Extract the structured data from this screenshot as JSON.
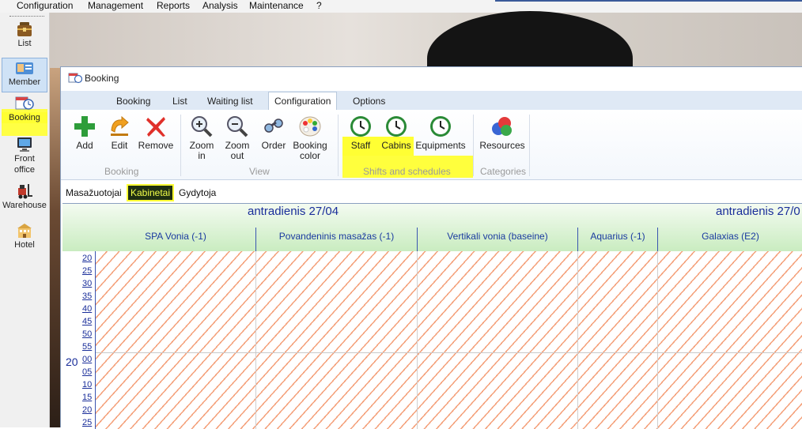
{
  "menu": {
    "items": [
      "Configuration",
      "Management",
      "Reports",
      "Analysis",
      "Maintenance",
      "?"
    ]
  },
  "sidebar": {
    "items": [
      {
        "label": "List",
        "icon": "briefcase-icon"
      },
      {
        "label": "Member",
        "icon": "member-card-icon",
        "selected": true
      },
      {
        "label": "Booking",
        "icon": "booking-icon",
        "highlighted": true
      },
      {
        "label": "Front office",
        "icon": "monitor-icon"
      },
      {
        "label": "Warehouse",
        "icon": "forklift-icon"
      },
      {
        "label": "Hotel",
        "icon": "hotel-icon"
      }
    ]
  },
  "window": {
    "title": "Booking",
    "tabs": [
      "Booking",
      "List",
      "Waiting list",
      "Configuration",
      "Options"
    ],
    "active_tab": "Configuration",
    "ribbon": {
      "groups": [
        {
          "label": "Booking",
          "buttons": [
            "Add",
            "Edit",
            "Remove"
          ]
        },
        {
          "label": "View",
          "buttons": [
            "Zoom in",
            "Zoom out",
            "Order",
            "Booking color"
          ]
        },
        {
          "label": "Shifts and schedules",
          "buttons": [
            "Staff",
            "Cabins",
            "Equipments"
          ]
        },
        {
          "label": "Categories",
          "buttons": [
            "Resources"
          ]
        }
      ],
      "zoom_in_lines": [
        "Zoom",
        "in"
      ],
      "zoom_out_lines": [
        "Zoom",
        "out"
      ],
      "booking_color_lines": [
        "Booking",
        "color"
      ]
    },
    "subtabs": [
      "Masažuotojai",
      "Kabinetai",
      "Gydytoja"
    ],
    "active_subtab": "Kabinetai"
  },
  "calendar": {
    "date_left": "antradienis 27/04",
    "date_right": "antradienis 27/0",
    "columns": [
      "SPA Vonia (-1)",
      "Povandeninis masažas (-1)",
      "Vertikali vonia (baseine)",
      "Aquarius (-1)",
      "Galaxias (E2)"
    ],
    "hour_label": "20",
    "minutes_before": [
      "20",
      "25",
      "30",
      "35",
      "40",
      "45",
      "50",
      "55"
    ],
    "minutes_after": [
      "00",
      "05",
      "10",
      "15",
      "20",
      "25"
    ]
  },
  "colors": {
    "highlight": "#ffff33",
    "hatch": "#f4a07a",
    "header_green": "#c9ecc0",
    "link_blue": "#1a2e9a"
  }
}
